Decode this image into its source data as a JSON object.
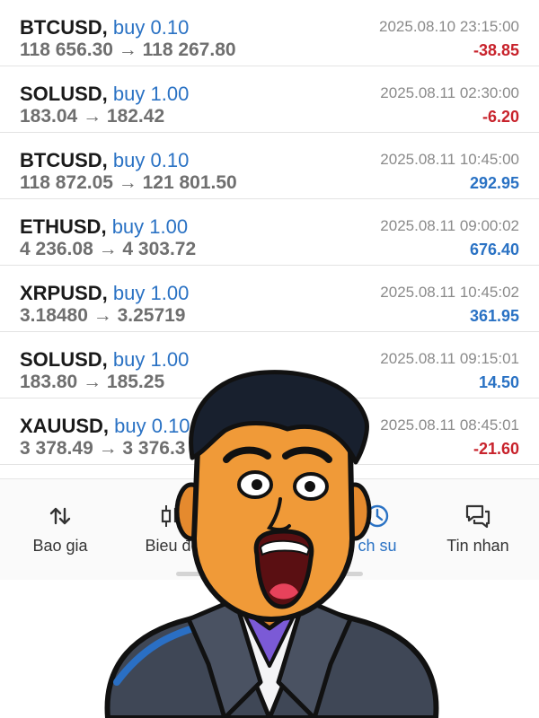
{
  "trades": [
    {
      "symbol": "BTCUSD,",
      "side": "buy 0.10",
      "prices": "118 656.30 → 118 267.80",
      "time": "2025.08.10 23:15:00",
      "profit": "-38.85",
      "sign": "neg"
    },
    {
      "symbol": "SOLUSD,",
      "side": "buy 1.00",
      "prices": "183.04 → 182.42",
      "time": "2025.08.11 02:30:00",
      "profit": "-6.20",
      "sign": "neg"
    },
    {
      "symbol": "BTCUSD,",
      "side": "buy 0.10",
      "prices": "118 872.05 → 121 801.50",
      "time": "2025.08.11 10:45:00",
      "profit": "292.95",
      "sign": "pos"
    },
    {
      "symbol": "ETHUSD,",
      "side": "buy 1.00",
      "prices": "4 236.08 → 4 303.72",
      "time": "2025.08.11 09:00:02",
      "profit": "676.40",
      "sign": "pos"
    },
    {
      "symbol": "XRPUSD,",
      "side": "buy 1.00",
      "prices": "3.18480 → 3.25719",
      "time": "2025.08.11 10:45:02",
      "profit": "361.95",
      "sign": "pos"
    },
    {
      "symbol": "SOLUSD,",
      "side": "buy 1.00",
      "prices": "183.80 → 185.25",
      "time": "2025.08.11 09:15:01",
      "profit": "14.50",
      "sign": "pos"
    },
    {
      "symbol": "XAUUSD,",
      "side": "buy 0.10",
      "prices": "3 378.49 → 3 376.3",
      "time": "2025.08.11 08:45:01",
      "profit": "-21.60",
      "sign": "neg"
    }
  ],
  "nav": {
    "items": [
      {
        "label": "Bao gia",
        "icon": "arrows-up-down-icon"
      },
      {
        "label": "Bieu đồ",
        "icon": "candlestick-icon"
      },
      {
        "label": "",
        "icon": "hidden"
      },
      {
        "label": "ch su",
        "icon": "clock-icon",
        "active": true
      },
      {
        "label": "Tin nhan",
        "icon": "chat-icon"
      }
    ]
  },
  "colors": {
    "buy_blue": "#2a72c4",
    "loss_red": "#c8232c",
    "text_gray": "#6f6f6f"
  }
}
